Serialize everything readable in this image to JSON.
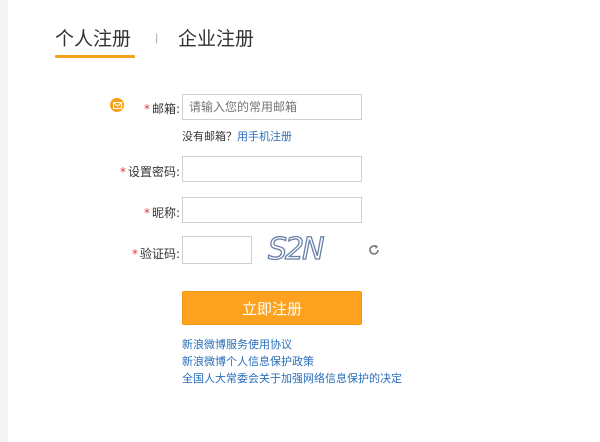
{
  "tabs": {
    "personal": "个人注册",
    "separator": "|",
    "enterprise": "企业注册"
  },
  "form": {
    "required_mark": "*",
    "email": {
      "label": "邮箱:",
      "placeholder": "请输入您的常用邮箱",
      "hint_text": "没有邮箱？",
      "hint_link": "用手机注册"
    },
    "password": {
      "label": "设置密码:"
    },
    "nickname": {
      "label": "昵称:"
    },
    "captcha": {
      "label": "验证码:",
      "image_text": "S2N"
    },
    "submit_label": "立即注册"
  },
  "links": [
    "新浪微博服务使用协议",
    "新浪微博个人信息保护政策",
    "全国人大常委会关于加强网络信息保护的决定"
  ],
  "colors": {
    "accent": "#f7a11b",
    "button": "#fda21f",
    "link": "#2a6ebb",
    "required": "#e4393c"
  },
  "icons": {
    "email": "envelope-icon",
    "refresh": "refresh-icon"
  }
}
